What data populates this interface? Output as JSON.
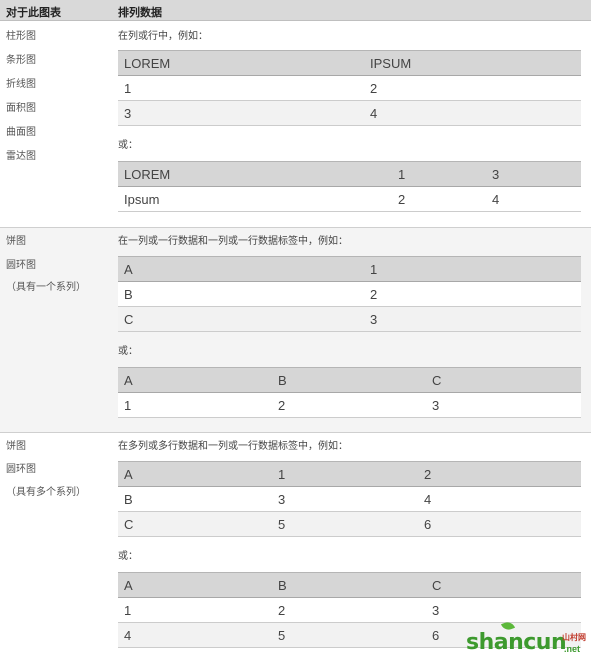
{
  "header": {
    "col1": "对于此图表",
    "col2": "排列数据"
  },
  "sections": [
    {
      "charts": [
        "柱形图",
        "条形图",
        "折线图",
        "面积图",
        "曲面图",
        "雷达图"
      ],
      "description": "在列或行中，例如：",
      "or_label": "或：",
      "table1": {
        "rows": [
          [
            "LOREM",
            "IPSUM"
          ],
          [
            "1",
            "2"
          ],
          [
            "3",
            "4"
          ]
        ]
      },
      "table2": {
        "rows": [
          [
            "LOREM",
            "1",
            "3"
          ],
          [
            "Ipsum",
            "2",
            "4"
          ]
        ]
      }
    },
    {
      "charts": [
        "饼图",
        "圆环图",
        "（具有一个系列）"
      ],
      "description": "在一列或一行数据和一列或一行数据标签中，例如：",
      "or_label": "或：",
      "table1": {
        "rows": [
          [
            "A",
            "1"
          ],
          [
            "B",
            "2"
          ],
          [
            "C",
            "3"
          ]
        ]
      },
      "table2": {
        "rows": [
          [
            "A",
            "B",
            "C"
          ],
          [
            "1",
            "2",
            "3"
          ]
        ]
      }
    },
    {
      "charts": [
        "饼图",
        "圆环图",
        "（具有多个系列）"
      ],
      "description": "在多列或多行数据和一列或一行数据标签中，例如：",
      "or_label": "或：",
      "table1": {
        "rows": [
          [
            "A",
            "1",
            "2"
          ],
          [
            "B",
            "3",
            "4"
          ],
          [
            "C",
            "5",
            "6"
          ]
        ]
      },
      "table2": {
        "rows": [
          [
            "A",
            "B",
            "C"
          ],
          [
            "1",
            "2",
            "3"
          ],
          [
            "4",
            "5",
            "6"
          ]
        ]
      }
    }
  ],
  "watermark": {
    "brand": "shancun",
    "cn": "山村网",
    "tld": ".net"
  },
  "colors": {
    "header_bg": "#d9d9d9",
    "table_header_bg": "#d6d6d6",
    "alt_row_bg": "#f2f2f2",
    "section2_bg": "#f4f4f4",
    "watermark_green": "#3d9a2e"
  }
}
